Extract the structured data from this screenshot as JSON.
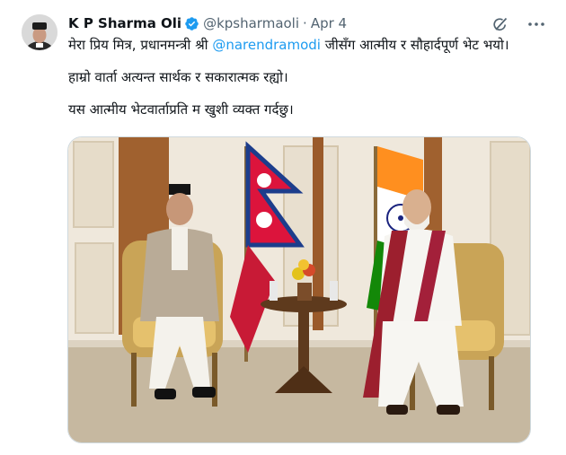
{
  "tweet": {
    "author_name": "K P Sharma Oli",
    "handle": "@kpsharmaoli",
    "separator": "·",
    "date": "Apr 4",
    "line1_before": "मेरा प्रिय मित्र, प्रधानमन्त्री श्री ",
    "mention": "@narendramodi",
    "line1_after": " जीसँग आत्मीय र सौहार्दपूर्ण भेट भयो।",
    "line2": "हाम्रो वार्ता अत्यन्त सार्थक र सकारात्मक रह्यो।",
    "line3": "यस आत्मीय भेटवार्ताप्रति म खुशी व्यक्त गर्दछु।"
  },
  "icons": {
    "verified": "verified-badge-icon",
    "grok": "grok-icon",
    "more": "more-options-icon"
  },
  "colors": {
    "text": "#0f1419",
    "secondary": "#536471",
    "link": "#1d9bf0",
    "verified": "#1d9bf0"
  }
}
